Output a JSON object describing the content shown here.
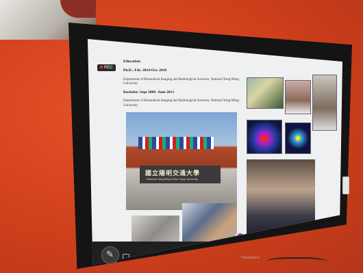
{
  "scene": {
    "screen": {
      "rec_label": "REC",
      "doc_text": {
        "education": "Education:",
        "phd": "Ph.D.: Feb. 2014-Oct. 2018",
        "phd_dept": "Department of Biomedical Imaging and Radiological Sciences, National Yang-Ming University",
        "bachelor": "Bachelor: Sept 2009- June 2013",
        "bachelor_dept": "Department of Biomedical Imaging and Radiological Sciences, National Yang-Ming University"
      },
      "campus_sign": "國立陽明交通大學",
      "campus_sign_en": "National Yang Ming Chiao Tung University"
    },
    "brand": "ViewSonic"
  }
}
